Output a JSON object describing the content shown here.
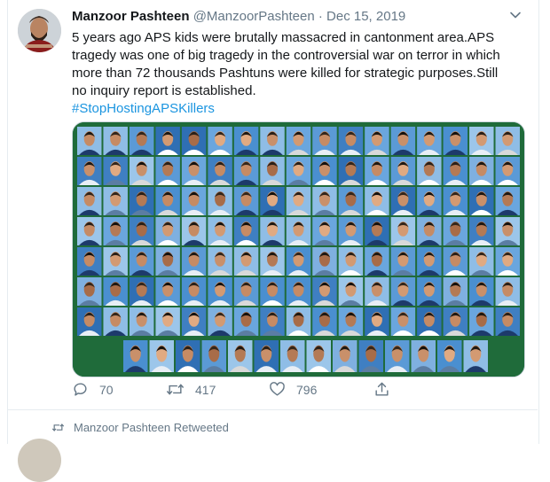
{
  "tweet": {
    "display_name": "Manzoor Pashteen",
    "handle": "@ManzoorPashteen",
    "separator": "·",
    "date": "Dec 15, 2019",
    "body": "5 years ago APS kids were brutally massacred in cantonment area.APS tragedy was one of big tragedy in the controversial war on terror in which more than 72 thousands Pashtuns were killed for strategic purposes.Still no inquiry report is established.",
    "hashtag": "#StopHostingAPSKillers",
    "actions": {
      "replies": "70",
      "retweets": "417",
      "likes": "796"
    }
  },
  "retweet_notice": "Manzoor Pashteen Retweeted",
  "colors": {
    "link": "#1b95e0",
    "muted": "#657786",
    "border": "#e6ecf0",
    "media_bg": "#1f6b3a"
  },
  "icons": [
    "caret-down-icon",
    "reply-icon",
    "retweet-icon",
    "like-icon",
    "share-icon"
  ]
}
